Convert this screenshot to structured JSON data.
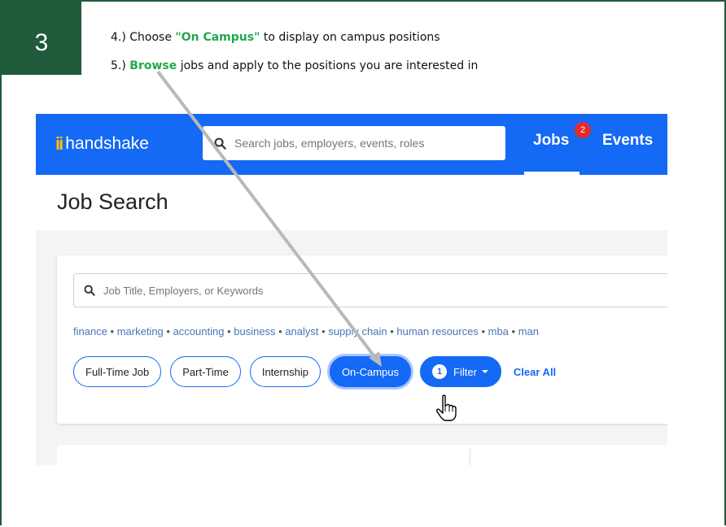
{
  "step": {
    "number": "3"
  },
  "instructions": {
    "line1_prefix": "4.) Choose ",
    "line1_highlight": "\"On Campus\"",
    "line1_suffix": " to display on campus positions",
    "line2_prefix": "5.) ",
    "line2_highlight": "Browse",
    "line2_suffix": " jobs and apply to the positions you are interested in"
  },
  "app": {
    "logo_text": "handshake",
    "search_placeholder": "Search jobs, employers, events, roles",
    "nav": {
      "jobs": "Jobs",
      "jobs_badge": "2",
      "events": "Events"
    },
    "page_title": "Job Search",
    "job_search_placeholder": "Job Title, Employers, or Keywords",
    "tags": [
      "finance",
      "marketing",
      "accounting",
      "business",
      "analyst",
      "supply chain",
      "human resources",
      "mba",
      "man"
    ],
    "filters": {
      "full_time": "Full-Time Job",
      "part_time": "Part-Time",
      "internship": "Internship",
      "on_campus": "On-Campus",
      "filter_count": "1",
      "filter_label": "Filter",
      "clear_all": "Clear All"
    }
  },
  "colors": {
    "badge_green": "#1f5a3a",
    "highlight_green": "#22a84a",
    "handshake_blue": "#1469f5",
    "notification_red": "#e52b2b"
  },
  "icons": [
    "search-icon",
    "chevron-down-icon",
    "hand-pointer-icon"
  ]
}
